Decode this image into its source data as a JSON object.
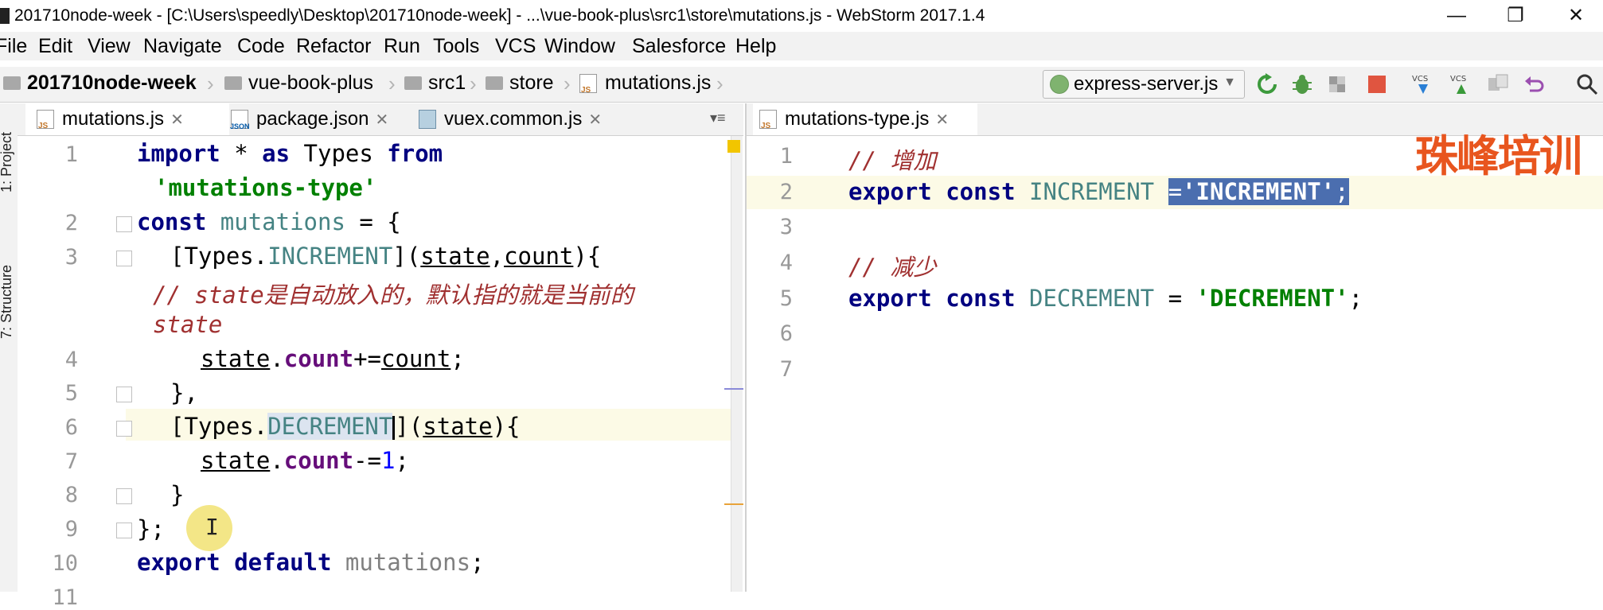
{
  "window": {
    "title": "201710node-week - [C:\\Users\\speedly\\Desktop\\201710node-week] - ...\\vue-book-plus\\src1\\store\\mutations.js - WebStorm 2017.1.4",
    "controls": {
      "minimize": "—",
      "maximize": "❐",
      "close": "✕"
    }
  },
  "menu": [
    "File",
    "Edit",
    "View",
    "Navigate",
    "Code",
    "Refactor",
    "Run",
    "Tools",
    "VCS",
    "Window",
    "Salesforce",
    "Help"
  ],
  "breadcrumb": [
    "201710node-week",
    "vue-book-plus",
    "src1",
    "store",
    "mutations.js"
  ],
  "run_config": {
    "label": "express-server.js"
  },
  "toolbar_icons": [
    "rerun-icon",
    "debug-icon",
    "coverage-icon",
    "stop-icon",
    "vcs-update-icon",
    "vcs-commit-icon",
    "vcs-compare-icon",
    "revert-icon",
    "search-icon"
  ],
  "side_panels": {
    "project": "1: Project",
    "structure": "7: Structure"
  },
  "left_editor": {
    "tabs": [
      {
        "label": "mutations.js",
        "icon": "js-file-icon",
        "active": true
      },
      {
        "label": "package.json",
        "icon": "json-file-icon",
        "active": false
      },
      {
        "label": "vuex.common.js",
        "icon": "library-file-icon",
        "active": false
      }
    ],
    "line_numbers": [
      "1",
      "2",
      "3",
      "",
      "4",
      "5",
      "6",
      "7",
      "8",
      "9",
      "10",
      "11"
    ],
    "code": {
      "l1_import": "import",
      "l1_star": " * ",
      "l1_as": "as",
      "l1_types": " Types ",
      "l1_from": "from",
      "l1b_str": "'mutations-type'",
      "l2_const": "const",
      "l2_name": " mutations",
      "l2_rest": " = {",
      "l3_open": "[Types.",
      "l3_id": "INCREMENT",
      "l3_close": "](",
      "l3_state": "state",
      "l3_comma": ",",
      "l3_count": "count",
      "l3_end": "){",
      "l3c_comment": "// state是自动放入的，默认指的就是当前的",
      "l3d_comment": "state",
      "l4_state": "state",
      "l4_dot": ".",
      "l4_prop": "count",
      "l4_op": "+=",
      "l4_count": "count",
      "l4_end": ";",
      "l5": "},",
      "l6_open": "[Types.",
      "l6_id": "DECREMENT",
      "l6_close": "](",
      "l6_state": "state",
      "l6_end": "){",
      "l7_state": "state",
      "l7_dot": ".",
      "l7_prop": "count",
      "l7_op": "-=",
      "l7_num": "1",
      "l7_end": ";",
      "l8": "}",
      "l9": "};",
      "l10_export": "export",
      "l10_default": " default",
      "l10_name": " mutations",
      "l10_end": ";"
    }
  },
  "right_editor": {
    "tabs": [
      {
        "label": "mutations-type.js",
        "icon": "js-file-icon",
        "active": true
      }
    ],
    "line_numbers": [
      "1",
      "2",
      "3",
      "4",
      "5",
      "6",
      "7"
    ],
    "code": {
      "l1_comment": "// 增加",
      "l2_export": "export",
      "l2_const": " const",
      "l2_name": " INCREMENT ",
      "l2_eq": "=",
      "l2_str": "'INCREMENT'",
      "l2_end": ";",
      "l4_comment": "// 减少",
      "l5_export": "export",
      "l5_const": " const",
      "l5_name": " DECREMENT",
      "l5_eq": " = ",
      "l5_str": "'DECREMENT'",
      "l5_end": ";"
    }
  },
  "watermark": "珠峰培训",
  "colors": {
    "keyword": "#000080",
    "string": "#008000",
    "selection": "#4b6eaf",
    "watermark": "#e8551e"
  }
}
